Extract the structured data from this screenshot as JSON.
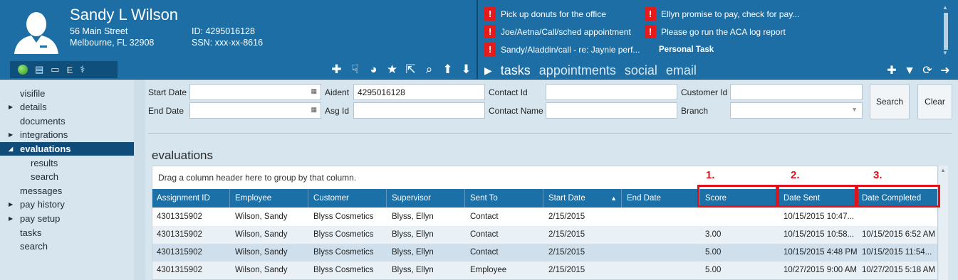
{
  "profile": {
    "name": "Sandy L Wilson",
    "address_line1": "56 Main Street",
    "address_line2": "Melbourne, FL 32908",
    "id": "ID: 4295016128",
    "ssn": "SSN: xxx-xx-8616"
  },
  "status_icons": [
    "E",
    "⚕"
  ],
  "tasks": [
    "Pick up donuts for the office",
    "Ellyn promise to pay, check for pay...",
    "Joe/Aetna/Call/sched appointment",
    "Please go run the ACA log report",
    "Sandy/Aladdin/call - re:  Jaynie perf...",
    "Personal Task"
  ],
  "header_tabs": [
    "tasks",
    "appointments",
    "social",
    "email"
  ],
  "sidebar": {
    "items": [
      "visifile",
      "details",
      "documents",
      "integrations",
      "evaluations",
      "results",
      "search",
      "messages",
      "pay history",
      "pay setup",
      "tasks",
      "search"
    ]
  },
  "filters": {
    "start_date_label": "Start Date",
    "end_date_label": "End Date",
    "aident_label": "Aident",
    "aident_value": "4295016128",
    "asg_id_label": "Asg Id",
    "contact_id_label": "Contact Id",
    "contact_name_label": "Contact Name",
    "customer_id_label": "Customer Id",
    "branch_label": "Branch",
    "search_button": "Search",
    "clear_button": "Clear"
  },
  "section_title": "evaluations",
  "grid": {
    "group_hint": "Drag a column header here to group by that column.",
    "columns": [
      "Assignment ID",
      "Employee",
      "Customer",
      "Supervisor",
      "Sent To",
      "Start Date",
      "End Date",
      "Score",
      "Date Sent",
      "Date Completed"
    ],
    "rows": [
      [
        "4301315902",
        "Wilson, Sandy",
        "Blyss Cosmetics",
        "Blyss, Ellyn",
        "Contact",
        "2/15/2015",
        "",
        "",
        "10/15/2015 10:47...",
        ""
      ],
      [
        "4301315902",
        "Wilson, Sandy",
        "Blyss Cosmetics",
        "Blyss, Ellyn",
        "Contact",
        "2/15/2015",
        "",
        "3.00",
        "10/15/2015 10:58...",
        "10/15/2015 6:52 AM"
      ],
      [
        "4301315902",
        "Wilson, Sandy",
        "Blyss Cosmetics",
        "Blyss, Ellyn",
        "Contact",
        "2/15/2015",
        "",
        "5.00",
        "10/15/2015 4:48 PM",
        "10/15/2015 11:54..."
      ],
      [
        "4301315902",
        "Wilson, Sandy",
        "Blyss Cosmetics",
        "Blyss, Ellyn",
        "Employee",
        "2/15/2015",
        "",
        "5.00",
        "10/27/2015 9:00 AM",
        "10/27/2015 5:18 AM"
      ]
    ]
  },
  "annotations": [
    "1.",
    "2.",
    "3."
  ],
  "colors": {
    "header_blue": "#1c6ea4",
    "active_nav": "#0f4c79",
    "alert_red": "#e31b1b",
    "annotation_red": "#e0121b"
  }
}
